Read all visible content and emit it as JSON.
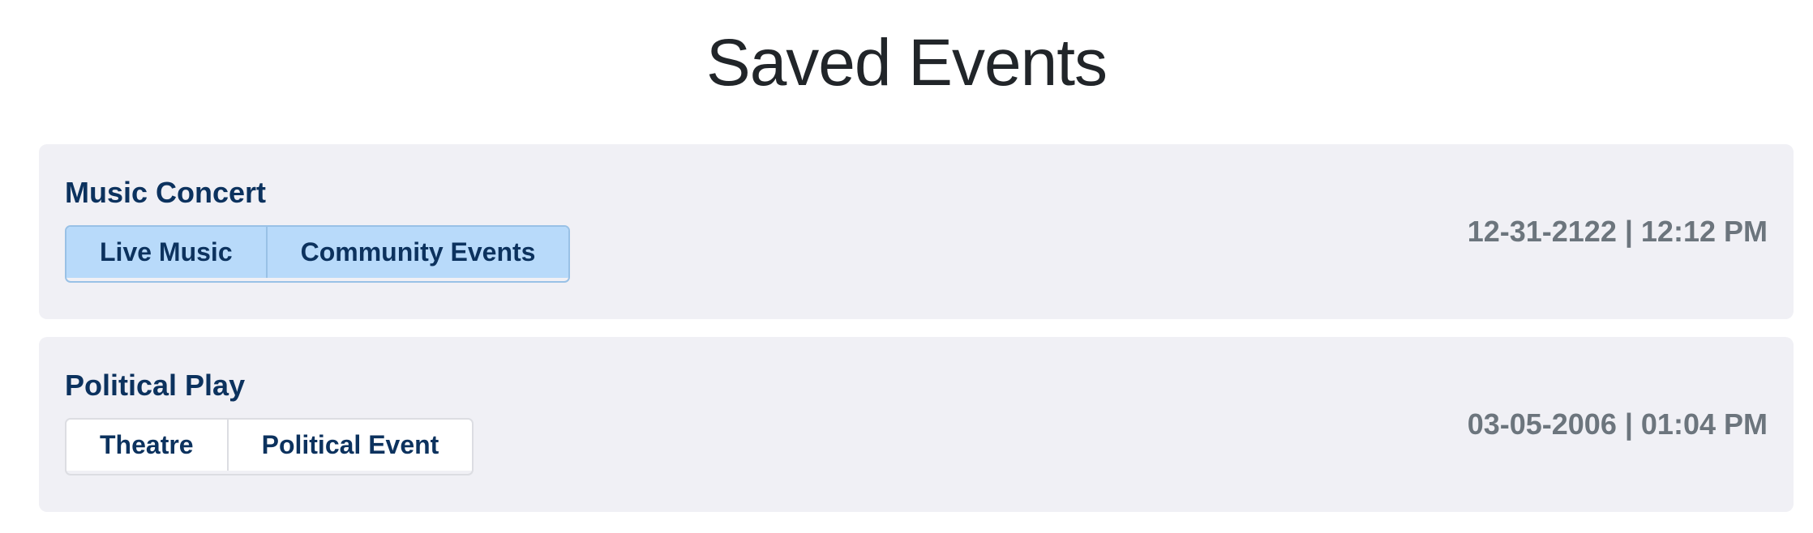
{
  "page": {
    "title": "Saved Events"
  },
  "events": [
    {
      "name": "Music Concert",
      "tags": [
        "Live Music",
        "Community Events"
      ],
      "tags_style": "selected",
      "datetime": "12-31-2122 | 12:12 PM"
    },
    {
      "name": "Political Play",
      "tags": [
        "Theatre",
        "Political Event"
      ],
      "tags_style": "plain",
      "datetime": "03-05-2006 | 01:04 PM"
    }
  ],
  "colors": {
    "title": "#212529",
    "card_background": "#f0f0f5",
    "event_name": "#0c325e",
    "selected_tag_background": "#b8dafa",
    "selected_tag_border": "#99c1e6",
    "plain_tag_background": "#ffffff",
    "datetime": "#6c757d"
  }
}
